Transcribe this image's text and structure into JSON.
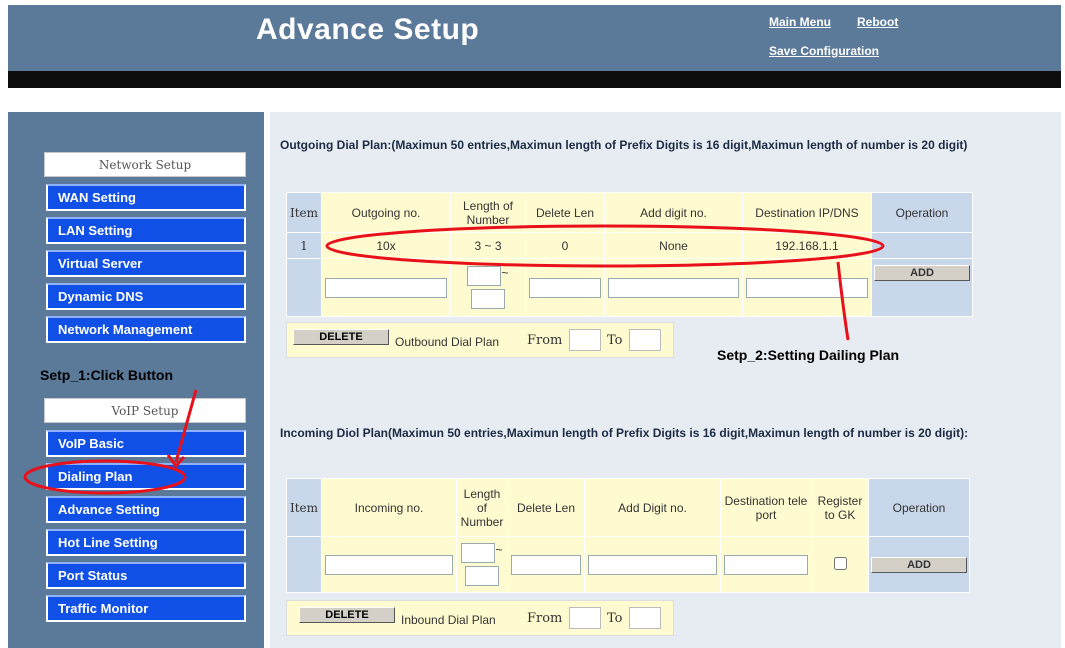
{
  "header": {
    "title": "Advance Setup",
    "main_menu": "Main Menu",
    "reboot": "Reboot",
    "save_configuration": "Save Configuration"
  },
  "sidebar": {
    "network_heading": "Network Setup",
    "network_items": [
      "WAN Setting",
      "LAN Setting",
      "Virtual Server",
      "Dynamic DNS",
      "Network Management"
    ],
    "voip_heading": "VoIP Setup",
    "voip_items": [
      "VoIP Basic",
      "Dialing Plan",
      "Advance Setting",
      "Hot Line Setting",
      "Port Status",
      "Traffic Monitor"
    ]
  },
  "annotations": {
    "step1": "Setp_1:Click Button",
    "step2": "Setp_2:Setting Dailing Plan",
    "color": "#e8101a"
  },
  "outgoing": {
    "description": "Outgoing Dial Plan:(Maximun 50 entries,Maximun length of Prefix Digits is 16 digit,Maximun length of number is 20 digit)",
    "headers": [
      "Item",
      "Outgoing no.",
      "Length of Number",
      "Delete Len",
      "Add digit no.",
      "Destination IP/DNS",
      "Operation"
    ],
    "rows": [
      {
        "item": "1",
        "number": "10x",
        "length": "3 ~ 3",
        "delete_len": "0",
        "add_digit": "None",
        "destination": "192.168.1.1"
      }
    ],
    "tilde": "~",
    "add_button": "ADD",
    "delete_button": "DELETE",
    "bar_label": "Outbound Dial Plan",
    "from_label": "From",
    "to_label": "To"
  },
  "incoming": {
    "description": "Incoming Diol Plan(Maximun 50 entries,Maximun length of Prefix Digits is 16 digit,Maximun length of number is 20 digit):",
    "headers": [
      "Item",
      "Incoming no.",
      "Length of Number",
      "Delete Len",
      "Add Digit no.",
      "Destination tele port",
      "Register to GK",
      "Operation"
    ],
    "tilde": "~",
    "add_button": "ADD",
    "delete_button": "DELETE",
    "bar_label": "Inbound Dial Plan",
    "from_label": "From",
    "to_label": "To"
  },
  "colors": {
    "header_bg": "#5b7a9a",
    "nav_button": "#1050e6",
    "table_header": "#fffbd0",
    "table_cell": "#c8d8ea"
  }
}
